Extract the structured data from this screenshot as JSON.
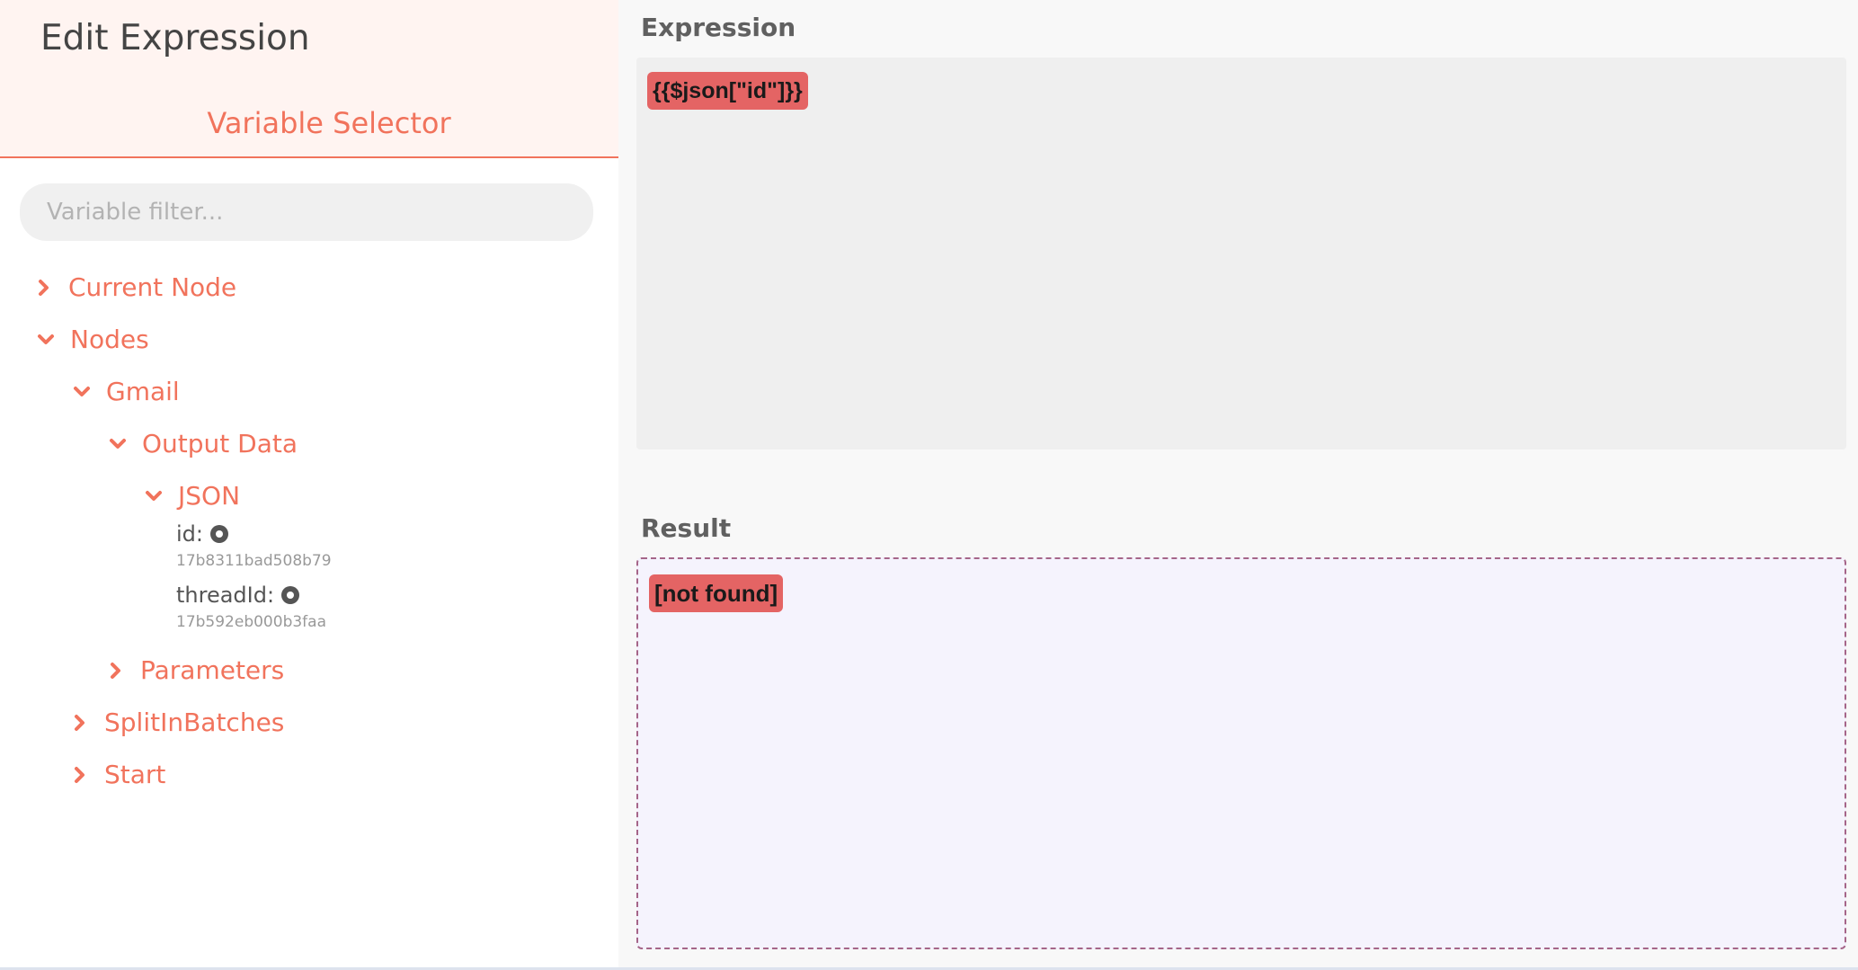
{
  "header": {
    "title": "Edit Expression",
    "selector_title": "Variable Selector"
  },
  "filter": {
    "placeholder": "Variable filter...",
    "value": ""
  },
  "tree": {
    "current_node": "Current Node",
    "nodes": "Nodes",
    "gmail": "Gmail",
    "output_data": "Output Data",
    "json": "JSON",
    "props": [
      {
        "name": "id:",
        "value": "17b8311bad508b79"
      },
      {
        "name": "threadId:",
        "value": "17b592eb000b3faa"
      }
    ],
    "parameters": "Parameters",
    "split_in_batches": "SplitInBatches",
    "start": "Start"
  },
  "expression": {
    "label": "Expression",
    "value": "{{$json[\"id\"]}}"
  },
  "result": {
    "label": "Result",
    "value": "[not found]"
  },
  "colors": {
    "accent": "#f1735c",
    "chip": "#e46464",
    "result_border": "#a56589"
  },
  "icons": {
    "collapsed": "chevron-right-icon",
    "expanded": "chevron-down-icon",
    "property": "radio-dot-icon"
  }
}
